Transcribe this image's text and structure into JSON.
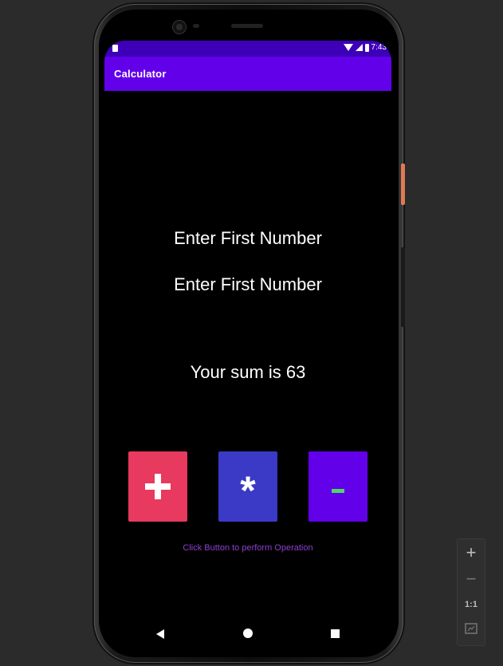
{
  "status_bar": {
    "time": "7:43"
  },
  "app": {
    "title": "Calculator"
  },
  "fields": {
    "first_number_placeholder": "Enter First Number",
    "second_number_placeholder": "Enter First Number"
  },
  "result_text": "Your sum is 63",
  "operations": [
    {
      "label": "+",
      "color": "#e8395f"
    },
    {
      "label": "*",
      "color": "#3a3ac6"
    },
    {
      "label": "-",
      "color": "#6200ea",
      "text_color": "#4cd964"
    }
  ],
  "hint": "Click Button to perform Operation",
  "nav_bar": {
    "back_icon": "triangle-back",
    "home_icon": "circle-home",
    "recents_icon": "square-recents"
  },
  "zoom_controls": {
    "zoom_in": "+",
    "zoom_out": "−",
    "actual_size": "1:1",
    "fit_icon": "fit-screen"
  }
}
